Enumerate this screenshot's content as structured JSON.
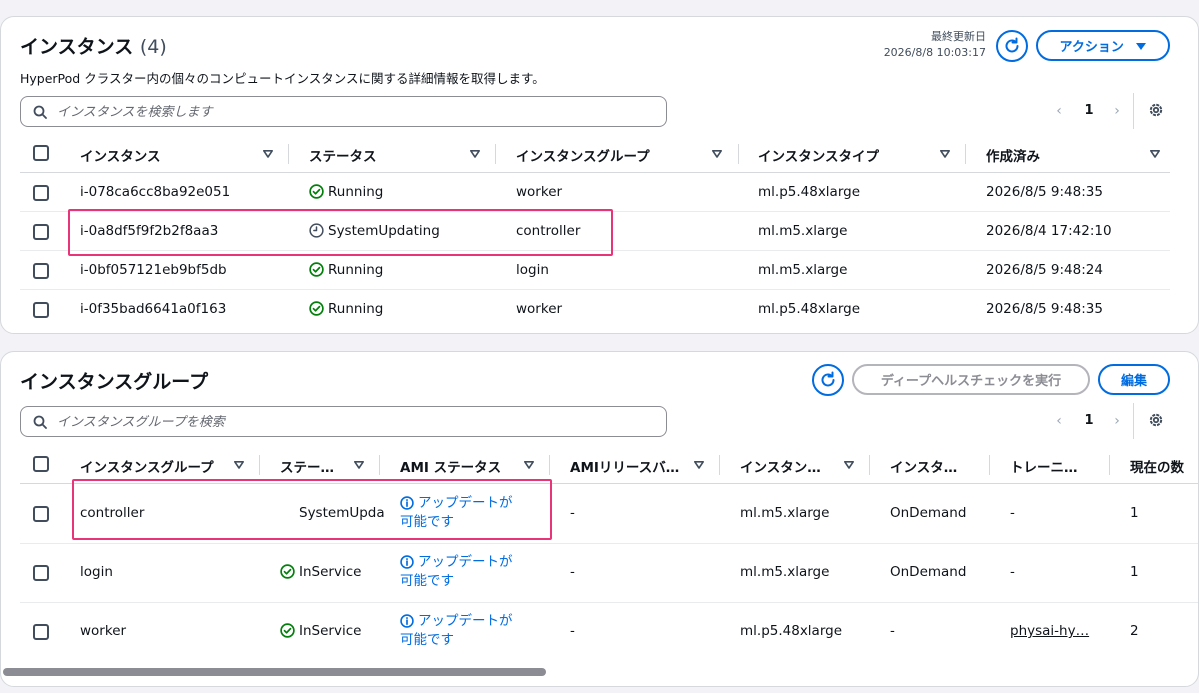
{
  "instances_panel": {
    "title": "インスタンス",
    "count": "(4)",
    "description": "HyperPod クラスター内の個々のコンピュートインスタンスに関する詳細情報を取得します。",
    "last_updated_label": "最終更新日",
    "last_updated_value": "2026/8/8 10:03:17",
    "actions_label": "アクション",
    "search_placeholder": "インスタンスを検索します",
    "page": "1",
    "columns": [
      "インスタンス",
      "ステータス",
      "インスタンスグループ",
      "インスタンスタイプ",
      "作成済み"
    ],
    "rows": [
      {
        "id": "i-078ca6cc8ba92e051",
        "status": "Running",
        "group": "worker",
        "type": "ml.p5.48xlarge",
        "created": "2026/8/5 9:48:35"
      },
      {
        "id": "i-0a8df5f9f2b2f8aa3",
        "status": "SystemUpdating",
        "group": "controller",
        "type": "ml.m5.xlarge",
        "created": "2026/8/4 17:42:10"
      },
      {
        "id": "i-0bf057121eb9bf5db",
        "status": "Running",
        "group": "login",
        "type": "ml.m5.xlarge",
        "created": "2026/8/5 9:48:24"
      },
      {
        "id": "i-0f35bad6641a0f163",
        "status": "Running",
        "group": "worker",
        "type": "ml.p5.48xlarge",
        "created": "2026/8/5 9:48:35"
      }
    ]
  },
  "groups_panel": {
    "title": "インスタンスグループ",
    "deep_health_label": "ディープヘルスチェックを実行",
    "edit_label": "編集",
    "search_placeholder": "インスタンスグループを検索",
    "page": "1",
    "columns": [
      "インスタンスグループ",
      "ステー…",
      "AMI ステータス",
      "AMIリリースバ…",
      "インスタン…",
      "インスタ…",
      "トレーニ…",
      "現在の数"
    ],
    "rows": [
      {
        "name": "controller",
        "status": "SystemUpda",
        "ami_line1": "アップデートが",
        "ami_line2": "可能です",
        "ami_release": "-",
        "type": "ml.m5.xlarge",
        "purchase": "OnDemand",
        "training": "-",
        "count": "1"
      },
      {
        "name": "login",
        "status": "InService",
        "ami_line1": "アップデートが",
        "ami_line2": "可能です",
        "ami_release": "-",
        "type": "ml.m5.xlarge",
        "purchase": "OnDemand",
        "training": "-",
        "count": "1"
      },
      {
        "name": "worker",
        "status": "InService",
        "ami_line1": "アップデートが",
        "ami_line2": "可能です",
        "ami_release": "-",
        "type": "ml.p5.48xlarge",
        "purchase": "-",
        "training": "physai-hy…",
        "count": "2"
      }
    ]
  },
  "colors": {
    "accent": "#006ce0",
    "success": "#037f0c",
    "highlight": "#e8357a"
  }
}
